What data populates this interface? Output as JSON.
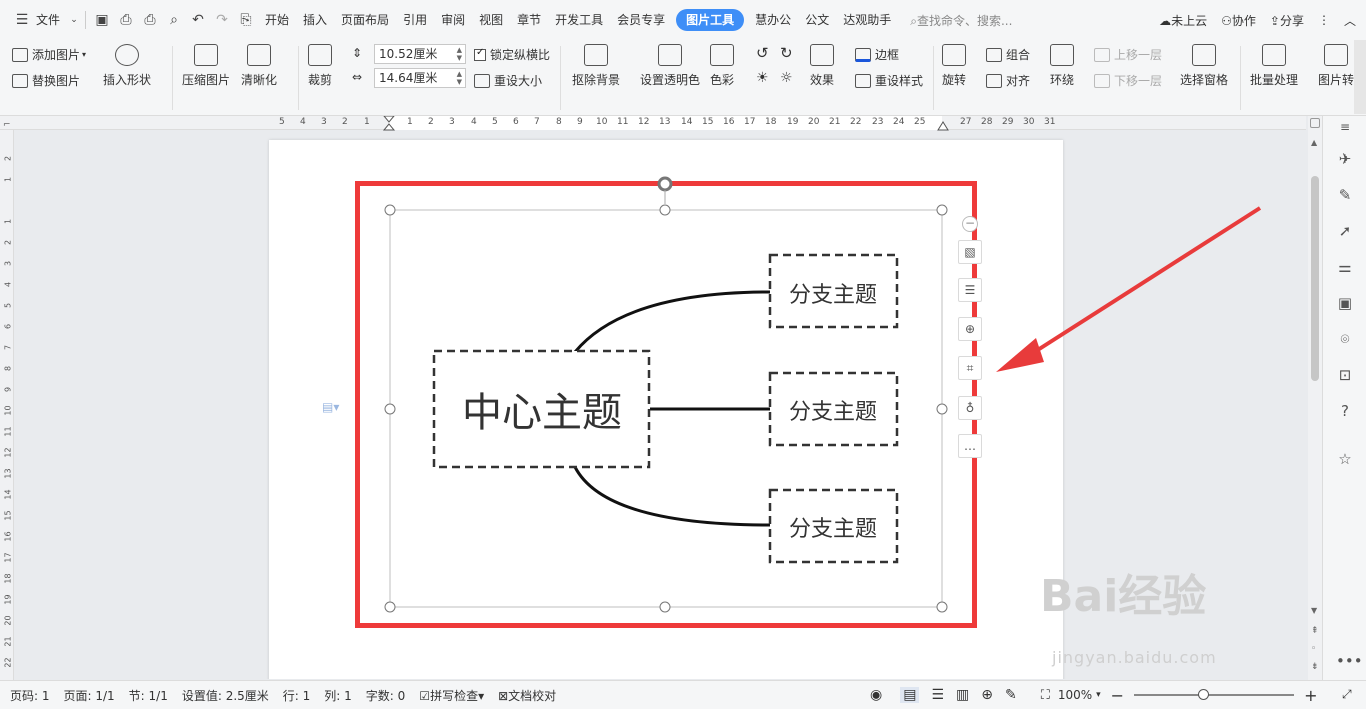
{
  "menubar": {
    "file": "文件",
    "tabs": [
      "开始",
      "插入",
      "页面布局",
      "引用",
      "审阅",
      "视图",
      "章节",
      "开发工具",
      "会员专享"
    ],
    "active_tab": "图片工具",
    "tabs_after": [
      "慧办公",
      "公文",
      "达观助手"
    ],
    "search": "查找命令、搜索...",
    "cloud": "未上云",
    "collab": "协作",
    "share": "分享"
  },
  "ribbon": {
    "add_image": "添加图片",
    "replace_image": "替换图片",
    "insert_shape": "插入形状",
    "compress": "压缩图片",
    "sharpen": "清晰化",
    "crop": "裁剪",
    "width": "10.52厘米",
    "height": "14.64厘米",
    "lock_ratio": "锁定纵横比",
    "reset_size": "重设大小",
    "remove_bg": "抠除背景",
    "set_transparent": "设置透明色",
    "color": "色彩",
    "effects": "效果",
    "border": "边框",
    "reset_style": "重设样式",
    "rotate": "旋转",
    "group": "组合",
    "align": "对齐",
    "wrap": "环绕",
    "bring_forward": "上移一层",
    "send_backward": "下移一层",
    "selection_pane": "选择窗格",
    "batch": "批量处理",
    "image_convert": "图片转"
  },
  "ruler": {
    "h_left": [
      "5",
      "4",
      "3",
      "2",
      "1"
    ],
    "h_right": [
      "1",
      "2",
      "3",
      "4",
      "5",
      "6",
      "7",
      "8",
      "9",
      "10",
      "11",
      "12",
      "13",
      "14",
      "15",
      "16",
      "17",
      "18",
      "19",
      "20",
      "21",
      "22",
      "23",
      "24",
      "25",
      "26",
      "27",
      "28",
      "29",
      "30",
      "31"
    ],
    "v": [
      "2",
      "1",
      "1",
      "2",
      "3",
      "4",
      "5",
      "6",
      "7",
      "8",
      "9",
      "10",
      "11",
      "12",
      "13",
      "14",
      "15",
      "16",
      "17",
      "18",
      "19",
      "20",
      "21",
      "22",
      "23"
    ]
  },
  "mindmap": {
    "center": "中心主题",
    "branches": [
      "分支主题",
      "分支主题",
      "分支主题"
    ]
  },
  "status": {
    "page_num": "页码: 1",
    "pages": "页面: 1/1",
    "section": "节: 1/1",
    "setting": "设置值: 2.5厘米",
    "row": "行: 1",
    "col": "列: 1",
    "words": "字数: 0",
    "spell": "拼写检查",
    "proof": "文档校对",
    "zoom": "100%"
  },
  "watermark": {
    "main": "Bai经验",
    "sub": "jingyan.baidu.com"
  },
  "colors": {
    "accent": "#3e8ef7",
    "highlight": "#ee3a3a",
    "arrow": "#e83b3b"
  }
}
